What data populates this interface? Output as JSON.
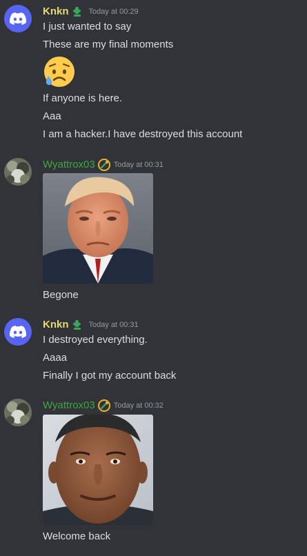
{
  "messages": [
    {
      "username": "Knkn",
      "timestamp": "Today at 00:29",
      "lines": [
        "I just wanted to say",
        "These are my final moments",
        "If anyone is here.",
        "Aaa",
        "I am a hacker.I have destroyed this account"
      ],
      "emoji": "sad-but-relieved-face-emoji"
    },
    {
      "username": "Wyattrox03",
      "timestamp": "Today at 00:31",
      "image": "mugshot-photo",
      "lines": [
        "Begone"
      ]
    },
    {
      "username": "Knkn",
      "timestamp": "Today at 00:31",
      "lines": [
        "I destroyed everything.",
        "Aaaa",
        "Finally I got my account back"
      ]
    },
    {
      "username": "Wyattrox03",
      "timestamp": "Today at 00:32",
      "image": "portrait-photo",
      "lines": [
        "Welcome back"
      ]
    }
  ],
  "colors": {
    "background": "#313338",
    "knkn_name": "#e6dc6e",
    "wyatt_name": "#3ea83e",
    "discord_blurple": "#5865f2",
    "timestamp": "#949ba4",
    "text": "#dbdee1"
  }
}
